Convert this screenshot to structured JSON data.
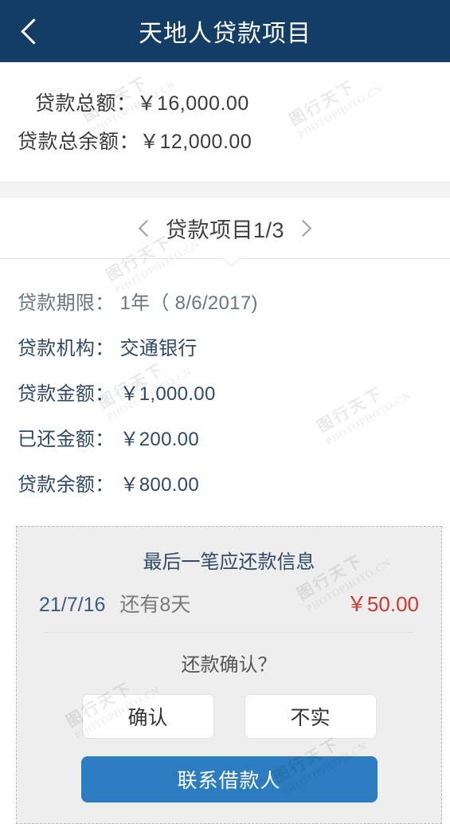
{
  "header": {
    "title": "天地人贷款项目",
    "back_icon": "chevron-left-icon"
  },
  "summary": {
    "total_label": "贷款总额：￥16,000.00",
    "balance_label": "贷款总余额：￥12,000.00"
  },
  "pager": {
    "prev_icon": "chevron-left-icon",
    "next_icon": "chevron-right-icon",
    "label": "贷款项目1/3"
  },
  "details": [
    {
      "text": "贷款期限： 1年（ 8/6/2017)"
    },
    {
      "text": "贷款机构： 交通银行"
    },
    {
      "text": "贷款金额： ￥1,000.00"
    },
    {
      "text": "已还金额： ￥200.00"
    },
    {
      "text": "贷款余额： ￥800.00"
    }
  ],
  "repayment_panel": {
    "title": "最后一笔应还款信息",
    "due_date": "21/7/16",
    "days_left": "还有8天",
    "amount": "￥50.00",
    "amount_color": "#cd3a33",
    "confirm_question": "还款确认？",
    "confirm_button": "确认",
    "deny_button": "不实",
    "contact_button": "联系借款人",
    "primary_color": "#2b7cc0"
  },
  "watermark": {
    "cn": "图行天下",
    "en": "PHOTOPHOTO.CN"
  }
}
